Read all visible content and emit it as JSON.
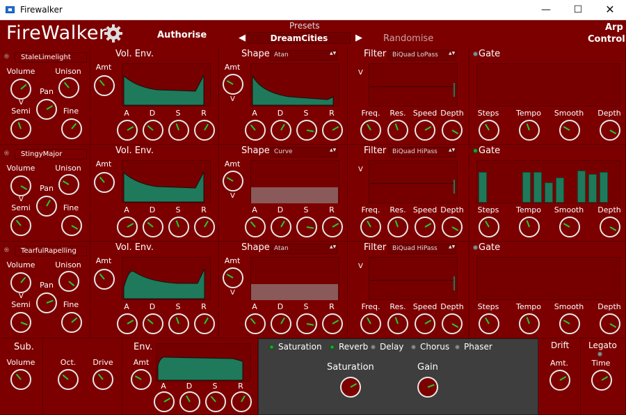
{
  "window": {
    "title": "Firewalker",
    "min": "—",
    "max": "☐",
    "close": "✕"
  },
  "header": {
    "logo": "FireWalker",
    "authorise": "Authorise",
    "presets_label": "Presets",
    "preset_name": "DreamCities",
    "randomise": "Randomise",
    "arp_line1": "Arp",
    "arp_line2": "Control",
    "prev": "◀",
    "next": "▶"
  },
  "osc": [
    {
      "name": "StaleLimelight",
      "filter_type": "BiQuad LoPass",
      "shape_type": "Atan",
      "gate_on": false,
      "shape_power": true
    },
    {
      "name": "StingyMajor",
      "filter_type": "BiQuad HiPass",
      "shape_type": "Curve",
      "gate_on": true,
      "shape_power": false
    },
    {
      "name": "TearfulRapelling",
      "filter_type": "BiQuad HiPass",
      "shape_type": "Atan",
      "gate_on": false,
      "shape_power": false
    }
  ],
  "labels": {
    "volume": "Volume",
    "unison": "Unison",
    "pan": "Pan",
    "semi": "Semi",
    "fine": "Fine",
    "vol_env": "Vol. Env.",
    "amt": "Amt",
    "power": "Power",
    "a": "A",
    "d": "D",
    "s": "S",
    "r": "R",
    "shape": "Shape",
    "filter": "Filter",
    "freq": "Freq.",
    "res": "Res.",
    "speed": "Speed",
    "depth": "Depth",
    "gate": "Gate",
    "steps": "Steps",
    "tempo": "Tempo",
    "smooth": "Smooth",
    "v": "V",
    "r_icon": "®"
  },
  "gate_bars": [
    0.75,
    0,
    0,
    0,
    0.75,
    0.75,
    0.5,
    0.62,
    0,
    0.8,
    0.7,
    0.75,
    0
  ],
  "bottom": {
    "sub": "Sub.",
    "volume": "Volume",
    "oct": "Oct.",
    "drive": "Drive",
    "env": "Env.",
    "amt": "Amt",
    "power": "Power",
    "drift": "Drift",
    "amt2": "Amt.",
    "legato": "Legato",
    "time": "Time"
  },
  "fx": {
    "tabs": [
      "Saturation",
      "Reverb",
      "Delay",
      "Chorus",
      "Phaser"
    ],
    "active": [
      true,
      true,
      false,
      false,
      false
    ],
    "knob1": "Saturation",
    "knob2": "Gain"
  },
  "colors": {
    "bg": "#7d0000",
    "accent": "#22cc33",
    "env": "#1e7a5a"
  }
}
